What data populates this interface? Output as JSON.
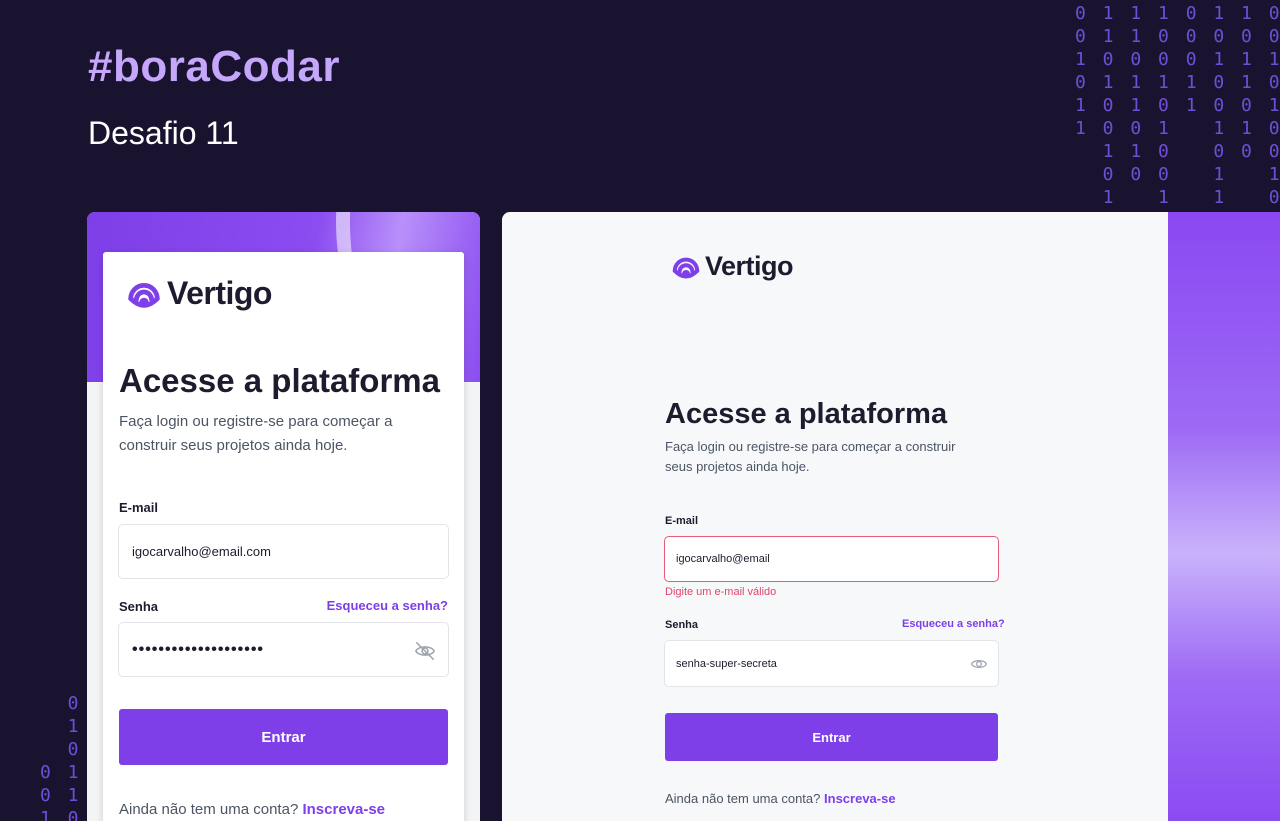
{
  "hero": {
    "title": "#boraCodar",
    "subtitle": "Desafio 11"
  },
  "binary_top": "0 1 1 1 0 1 1 0 0\n0 1 1 0 0 0 0 0 0\n1 0 0 0 0 1 1 1\n0 1 1 1 1 0 1 0\n1 0 1 0 1 0 0 1\n1 0 0 1   1 1 0\n  1 1 0   0 0 0\n  0 0 0   1   1\n  1   1   1   0",
  "binary_bottom": "  0\n  1 1\n  0 0\n0 1 1\n0 1 1\n1 0 0",
  "brand": {
    "name": "Vertigo",
    "accent": "#7e3fe8",
    "error_color": "#e0466a"
  },
  "mobile": {
    "heading": "Acesse a plataforma",
    "description": "Faça login ou registre-se para começar a construir seus projetos ainda hoje.",
    "email_label": "E-mail",
    "email_value": "igocarvalho@email.com",
    "password_label": "Senha",
    "forgot_label": "Esqueceu a senha?",
    "password_value": "••••••••••••••••••••",
    "password_icon": "eye-off-icon",
    "submit_label": "Entrar",
    "signup_prompt": "Ainda não tem uma conta?",
    "signup_link": "Inscreva-se"
  },
  "desktop": {
    "heading": "Acesse a plataforma",
    "description": "Faça login ou registre-se para começar a construir seus projetos ainda hoje.",
    "email_label": "E-mail",
    "email_value": "igocarvalho@email",
    "email_error": "Digite um e-mail válido",
    "password_label": "Senha",
    "forgot_label": "Esqueceu a senha?",
    "password_value": "senha-super-secreta",
    "password_icon": "eye-icon",
    "submit_label": "Entrar",
    "signup_prompt": "Ainda não tem uma conta?",
    "signup_link": "Inscreva-se"
  }
}
